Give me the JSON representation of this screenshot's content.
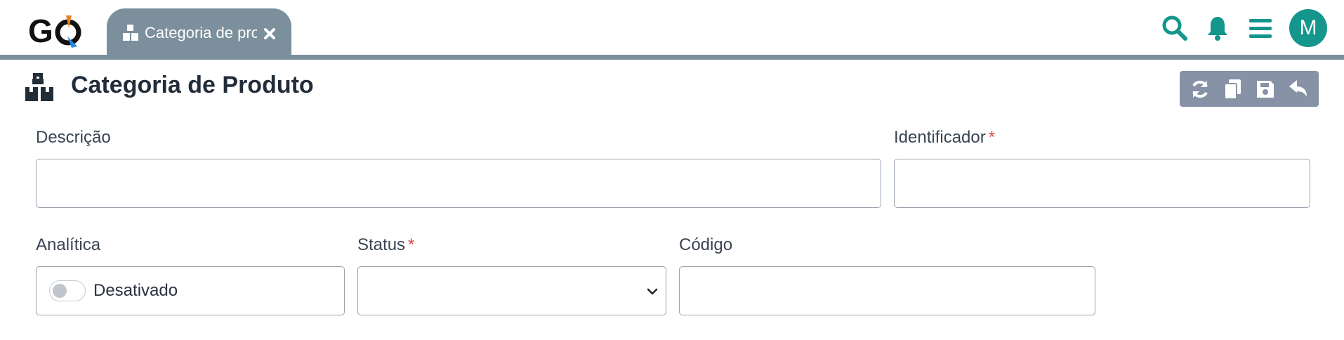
{
  "brand": {
    "logo_text": "GO",
    "accent": "#14968d",
    "logo_orange": "#e8821e",
    "logo_blue": "#1e88e5"
  },
  "tab": {
    "label": "Categoria de produto",
    "icon": "boxes-icon",
    "close_icon": "close-icon"
  },
  "header_icons": [
    "search-icon",
    "bell-icon",
    "menu-icon"
  ],
  "user": {
    "avatar_initial": "M"
  },
  "page": {
    "title": "Categoria de Produto",
    "icon": "boxes-icon"
  },
  "toolbar": {
    "buttons": [
      "refresh-icon",
      "copy-icon",
      "save-icon",
      "undo-icon"
    ],
    "background": "#8892a6"
  },
  "form": {
    "descricao": {
      "label": "Descrição",
      "value": "",
      "required": false
    },
    "identificador": {
      "label": "Identificador",
      "required_mark": "*",
      "value": ""
    },
    "analitica": {
      "label": "Analítica",
      "toggle_label": "Desativado",
      "enabled": false
    },
    "status": {
      "label": "Status",
      "required_mark": "*",
      "value": ""
    },
    "codigo": {
      "label": "Código",
      "value": ""
    }
  },
  "colors": {
    "tab_bar": "#7b8f9c",
    "required": "#d94a4a"
  }
}
